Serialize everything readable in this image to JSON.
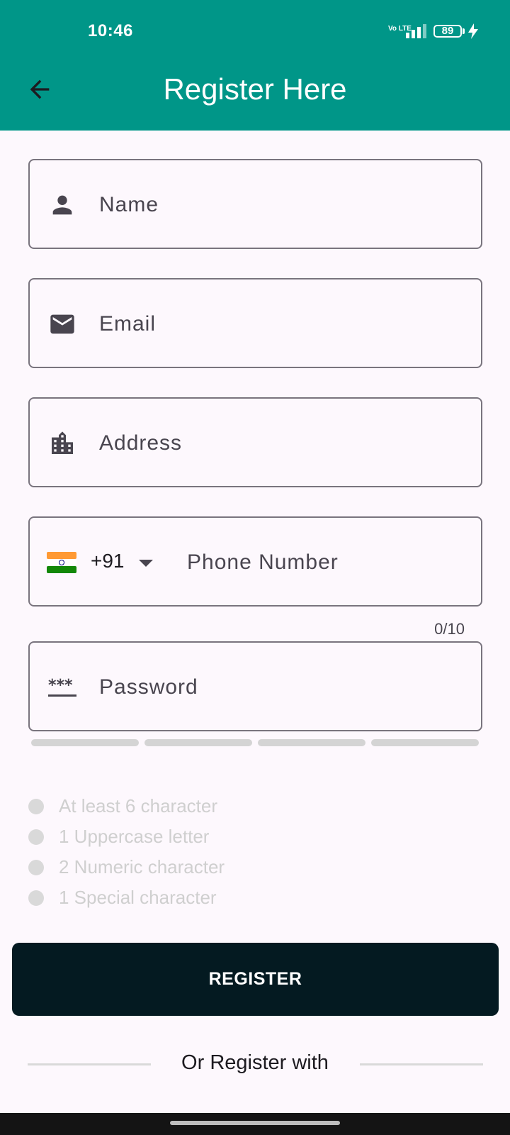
{
  "status_bar": {
    "time": "10:46",
    "network_label": "Vo LTE",
    "battery_level": "89"
  },
  "app_bar": {
    "title": "Register Here"
  },
  "form": {
    "name": {
      "placeholder": "Name",
      "value": ""
    },
    "email": {
      "placeholder": "Email",
      "value": ""
    },
    "address": {
      "placeholder": "Address",
      "value": ""
    },
    "phone": {
      "country_code": "+91",
      "flag": "india-flag-icon",
      "placeholder": "Phone Number",
      "value": "",
      "counter": "0/10"
    },
    "password": {
      "placeholder": "Password",
      "value": "",
      "strength_segments_filled": 0,
      "strength_segments_total": 4
    }
  },
  "password_rules": [
    {
      "label": "At least 6 character",
      "met": false
    },
    {
      "label": "1 Uppercase letter",
      "met": false
    },
    {
      "label": "2 Numeric character",
      "met": false
    },
    {
      "label": "1 Special character",
      "met": false
    }
  ],
  "register_button": {
    "label": "REGISTER"
  },
  "divider": {
    "label": "Or Register with"
  },
  "colors": {
    "app_bar": "#009688",
    "register_button": "#041a21",
    "field_border": "#79747e",
    "rule_inactive": "#cfcfcf"
  }
}
